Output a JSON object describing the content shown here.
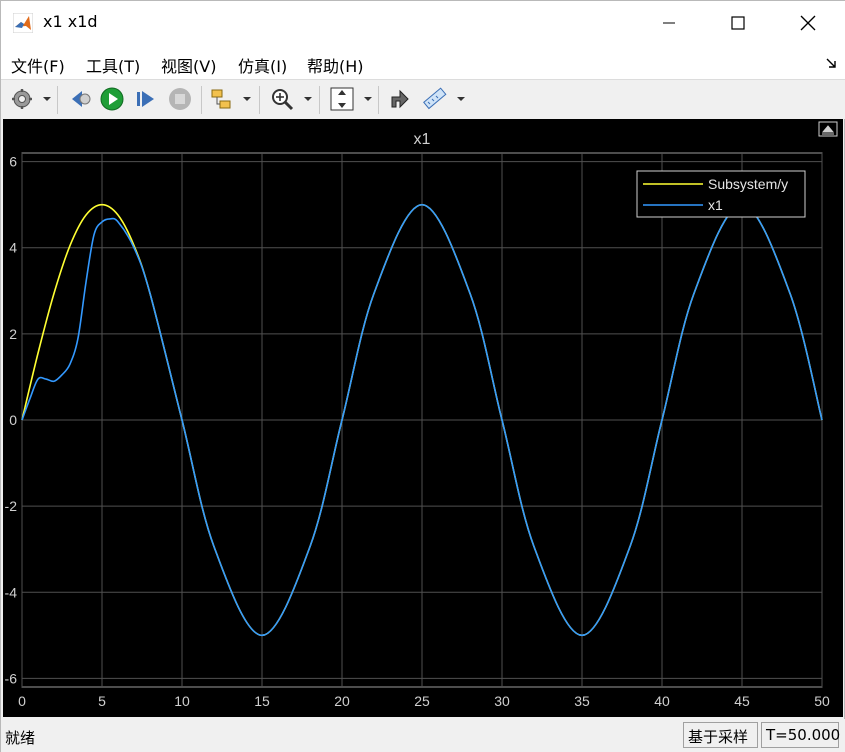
{
  "window": {
    "title": "x1 x1d"
  },
  "menu": [
    {
      "label": "文件(F)"
    },
    {
      "label": "工具(T)"
    },
    {
      "label": "视图(V)"
    },
    {
      "label": "仿真(I)"
    },
    {
      "label": "帮助(H)"
    }
  ],
  "toolbar": {
    "buttons": [
      "settings-icon",
      "step-back-icon",
      "run-icon",
      "step-forward-icon",
      "stop-icon",
      "highlight-block-icon",
      "zoom-in-icon",
      "autoscale-icon",
      "restore-view-icon",
      "measure-icon"
    ]
  },
  "status": {
    "left": "就绪",
    "sample_mode": "基于采样",
    "time": "T=50.000"
  },
  "colors": {
    "yellow": "#ffff33",
    "blue": "#3399ff",
    "grid": "#505050",
    "axis_text": "#d0d0d0"
  },
  "chart_data": {
    "type": "line",
    "title": "x1",
    "xlabel": "",
    "ylabel": "",
    "xlim": [
      0,
      50
    ],
    "ylim": [
      -6.2,
      6.2
    ],
    "xticks": [
      0,
      5,
      10,
      15,
      20,
      25,
      30,
      35,
      40,
      45,
      50
    ],
    "yticks": [
      -6,
      -4,
      -2,
      0,
      2,
      4,
      6
    ],
    "grid": true,
    "legend_position": "top-right",
    "series": [
      {
        "name": "Subsystem/y",
        "color": "#ffff33",
        "x": [
          0,
          1,
          2,
          3,
          4,
          5,
          6,
          7,
          8,
          10,
          12,
          15,
          18,
          20,
          22,
          25,
          28,
          30,
          32,
          35,
          38,
          40,
          42,
          45,
          48,
          50
        ],
        "y": [
          0,
          1.55,
          2.94,
          4.05,
          4.76,
          5.0,
          4.76,
          4.05,
          2.94,
          0,
          -2.94,
          -5.0,
          -2.94,
          0,
          2.94,
          5.0,
          2.94,
          0,
          -2.94,
          -5.0,
          -2.94,
          0,
          2.94,
          5.0,
          2.94,
          0
        ]
      },
      {
        "name": "x1",
        "color": "#3399ff",
        "x": [
          0,
          0.5,
          1,
          1.5,
          2,
          2.5,
          3,
          3.5,
          4,
          4.5,
          5,
          5.5,
          6,
          7,
          8,
          10,
          12,
          15,
          18,
          20,
          22,
          25,
          28,
          30,
          32,
          35,
          38,
          40,
          42,
          45,
          48,
          50
        ],
        "y": [
          0,
          0.5,
          0.95,
          0.95,
          0.9,
          1.05,
          1.3,
          1.9,
          3.2,
          4.3,
          4.6,
          4.67,
          4.6,
          4.0,
          2.94,
          0,
          -2.94,
          -5.0,
          -2.94,
          0,
          2.94,
          5.0,
          2.94,
          0,
          -2.94,
          -5.0,
          -2.94,
          0,
          2.94,
          5.0,
          2.94,
          0
        ]
      }
    ]
  }
}
